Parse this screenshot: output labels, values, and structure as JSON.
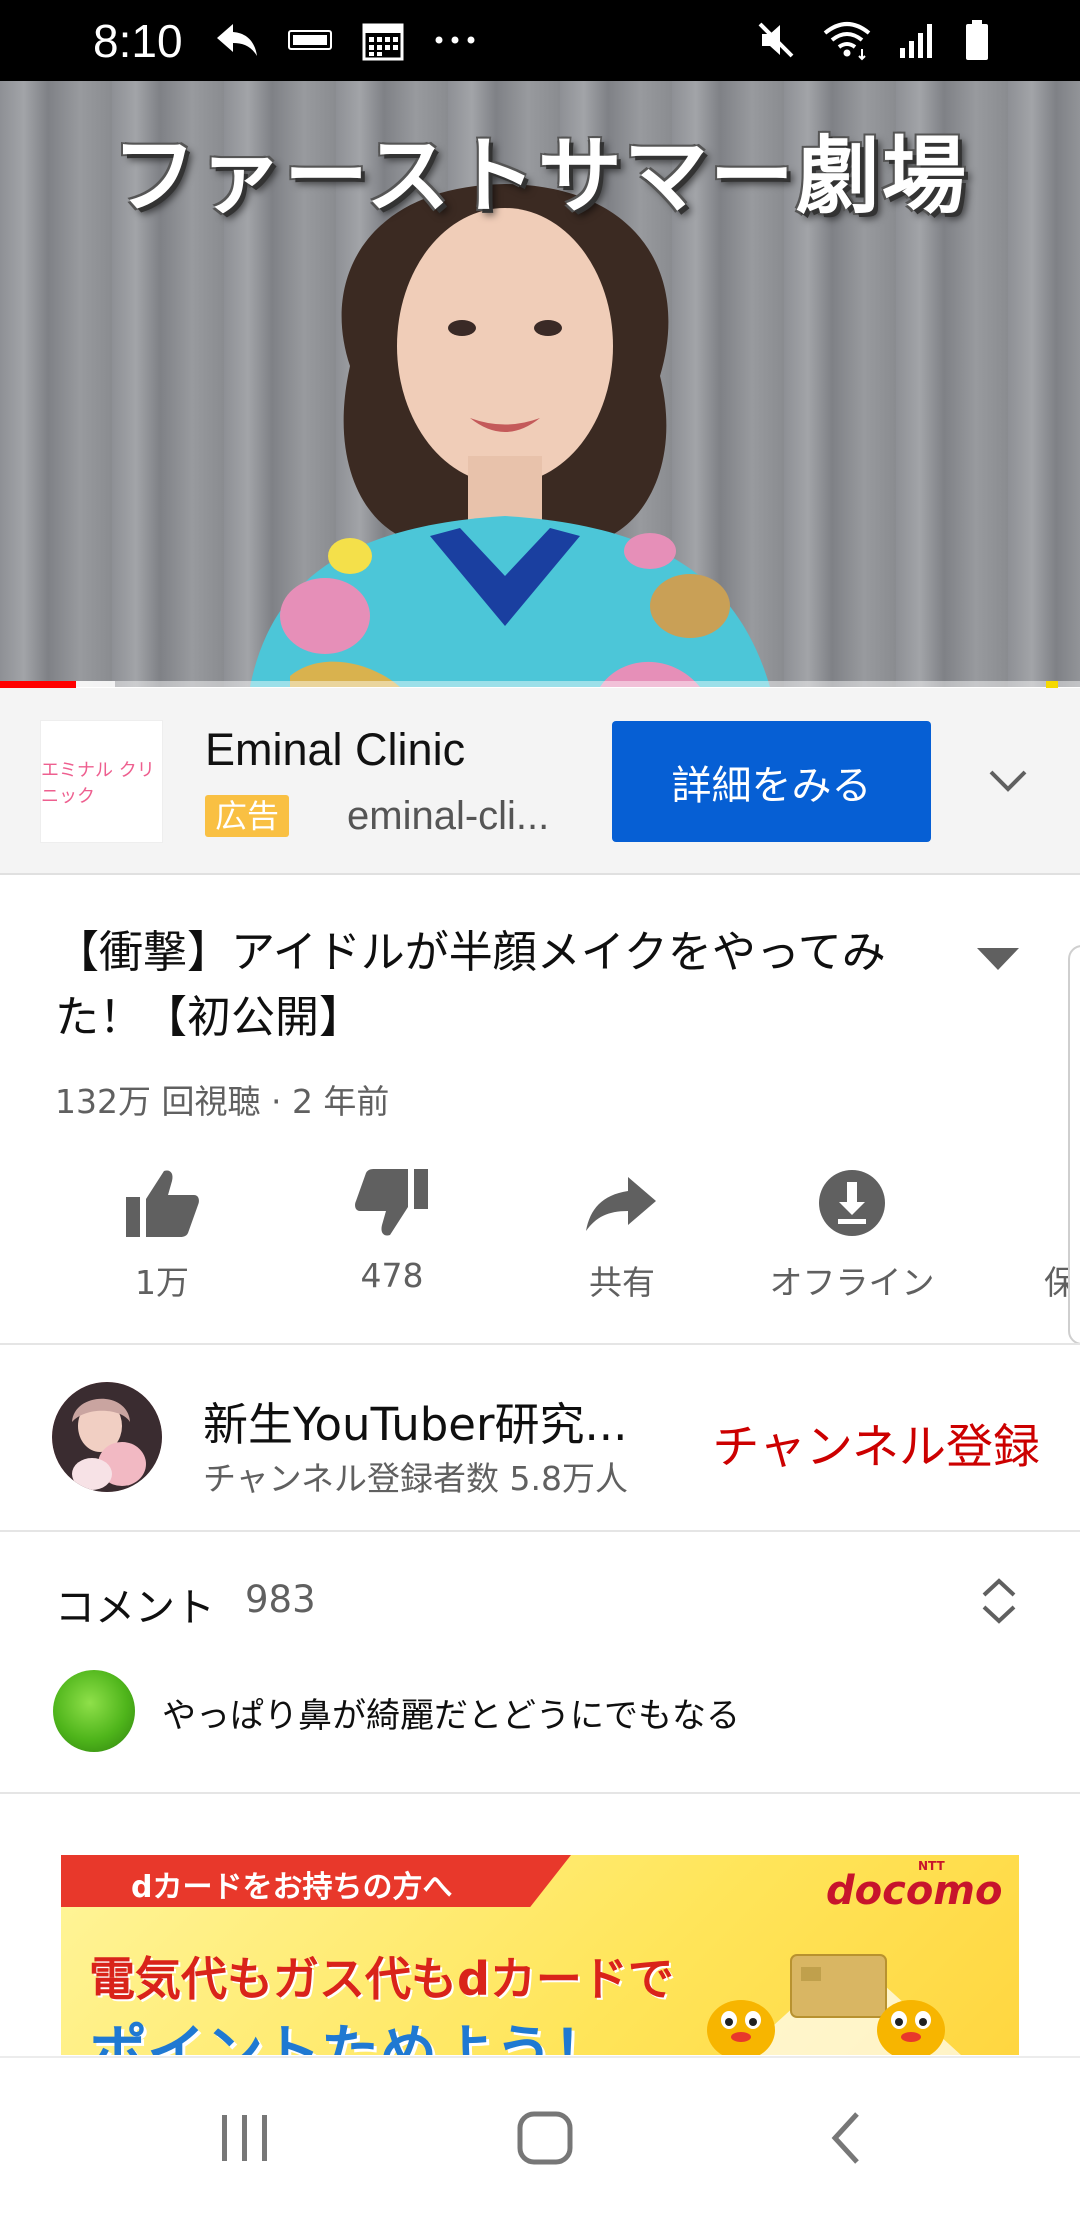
{
  "status_bar": {
    "time": "8:10",
    "left_icons": [
      "reply-icon",
      "sports-app-icon",
      "calendar-icon",
      "more-dots-icon"
    ],
    "right_icons": [
      "mute-icon",
      "wifi-icon",
      "signal-icon",
      "battery-icon"
    ]
  },
  "video": {
    "overlay_title": "ファーストサマー劇場",
    "progress_played": 0.07
  },
  "ad": {
    "logo_text": "エミナル クリニック",
    "advertiser": "Eminal Clinic",
    "badge": "広告",
    "domain": "eminal-cli...",
    "cta": "詳細をみる"
  },
  "video_info": {
    "title": "【衝撃】アイドルが半顔メイクをやってみた！【初公開】",
    "meta": "132万 回視聴 · 2 年前"
  },
  "actions": [
    {
      "label": "1万",
      "icon": "thumbs-up-icon"
    },
    {
      "label": "478",
      "icon": "thumbs-down-icon"
    },
    {
      "label": "共有",
      "icon": "share-icon"
    },
    {
      "label": "オフライン",
      "icon": "download-icon"
    },
    {
      "label": "保",
      "icon": "save-icon"
    }
  ],
  "channel": {
    "name": "新生YouTuber研究...",
    "subscribers": "チャンネル登録者数 5.8万人",
    "subscribe_label": "チャンネル登録"
  },
  "comments": {
    "label": "コメント",
    "count": "983",
    "top_comment": "やっぱり鼻が綺麗だとどうにでもなる"
  },
  "banner_ad": {
    "ribbon": "dカードをお持ちの方へ",
    "brand_small": "NTT",
    "brand": "docomo",
    "line1": "電気代もガス代もdカードで",
    "line2": "ポイントためよう！"
  },
  "nav_bar": {
    "buttons": [
      "recents-icon",
      "home-icon",
      "back-icon"
    ]
  },
  "colors": {
    "accent_blue": "#065fd4",
    "subscribe_red": "#cc0000",
    "progress_red": "#ff0000",
    "ad_badge": "#f9c043"
  }
}
